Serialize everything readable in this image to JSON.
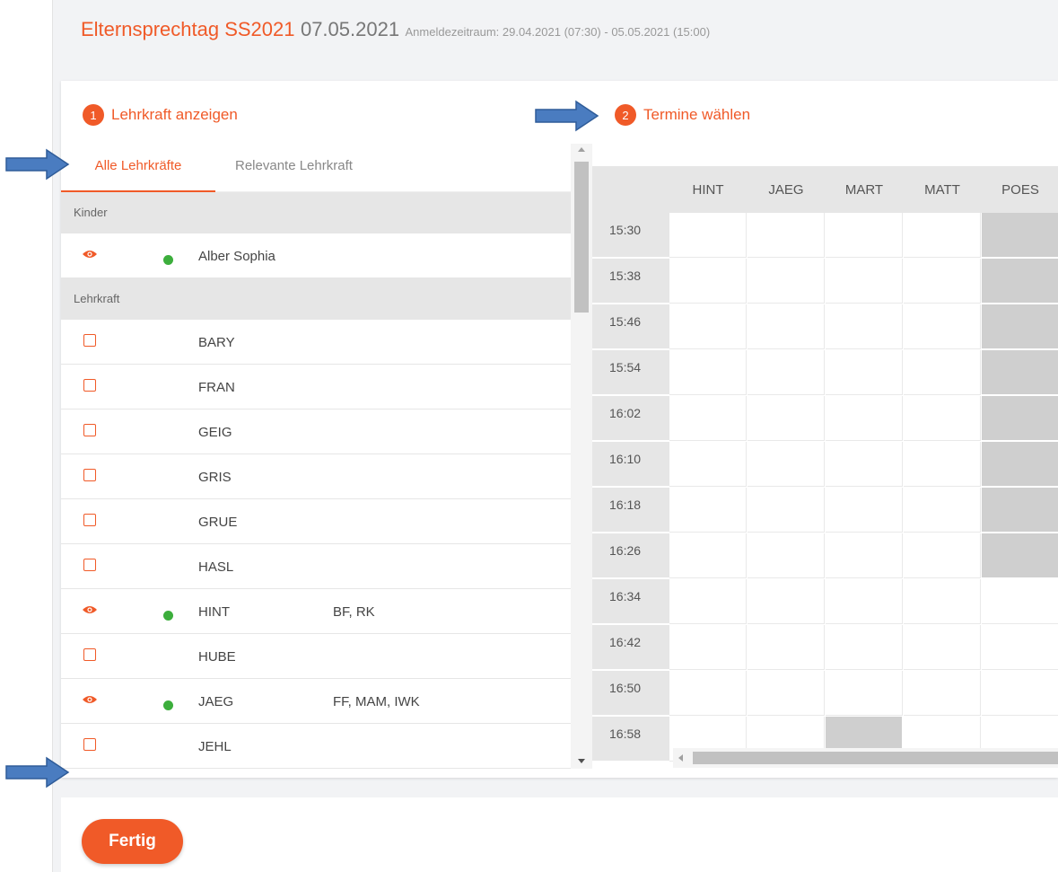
{
  "header": {
    "title": "Elternsprechtag SS2021",
    "date": "07.05.2021",
    "period": "Anmeldezeitraum: 29.04.2021 (07:30) - 05.05.2021 (15:00)"
  },
  "step1": {
    "num": "1",
    "label": "Lehrkraft anzeigen"
  },
  "step2": {
    "num": "2",
    "label": "Termine wählen"
  },
  "tabs": {
    "all": "Alle Lehrkräfte",
    "relevant": "Relevante Lehrkraft"
  },
  "sections": {
    "kinder": "Kinder",
    "lehrkraft": "Lehrkraft"
  },
  "children": [
    {
      "name": "Alber Sophia",
      "visible": true
    }
  ],
  "teachers": [
    {
      "name": "BARY",
      "extra": "",
      "selected": false
    },
    {
      "name": "FRAN",
      "extra": "",
      "selected": false
    },
    {
      "name": "GEIG",
      "extra": "",
      "selected": false
    },
    {
      "name": "GRIS",
      "extra": "",
      "selected": false
    },
    {
      "name": "GRUE",
      "extra": "",
      "selected": false
    },
    {
      "name": "HASL",
      "extra": "",
      "selected": false
    },
    {
      "name": "HINT",
      "extra": "BF, RK",
      "selected": true
    },
    {
      "name": "HUBE",
      "extra": "",
      "selected": false
    },
    {
      "name": "JAEG",
      "extra": "FF, MAM, IWK",
      "selected": true
    },
    {
      "name": "JEHL",
      "extra": "",
      "selected": false
    }
  ],
  "schedule": {
    "columns": [
      "HINT",
      "JAEG",
      "MART",
      "MATT",
      "POES"
    ],
    "times": [
      "15:30",
      "15:38",
      "15:46",
      "15:54",
      "16:02",
      "16:10",
      "16:18",
      "16:26",
      "16:34",
      "16:42",
      "16:50",
      "16:58"
    ],
    "busy": [
      [
        false,
        false,
        false,
        false,
        true
      ],
      [
        false,
        false,
        false,
        false,
        true
      ],
      [
        false,
        false,
        false,
        false,
        true
      ],
      [
        false,
        false,
        false,
        false,
        true
      ],
      [
        false,
        false,
        false,
        false,
        true
      ],
      [
        false,
        false,
        false,
        false,
        true
      ],
      [
        false,
        false,
        false,
        false,
        true
      ],
      [
        false,
        false,
        false,
        false,
        true
      ],
      [
        false,
        false,
        false,
        false,
        false
      ],
      [
        false,
        false,
        false,
        false,
        false
      ],
      [
        false,
        false,
        false,
        false,
        false
      ],
      [
        false,
        false,
        true,
        false,
        false
      ]
    ]
  },
  "footer": {
    "done_label": "Fertig"
  },
  "colors": {
    "accent": "#f05a28",
    "status_green": "#3cae3c",
    "arrow_blue": "#4a7cc0"
  },
  "icons": {
    "eye": "eye-icon",
    "checkbox": "checkbox-icon",
    "status": "status-dot",
    "arrow": "arrow-right-icon"
  }
}
